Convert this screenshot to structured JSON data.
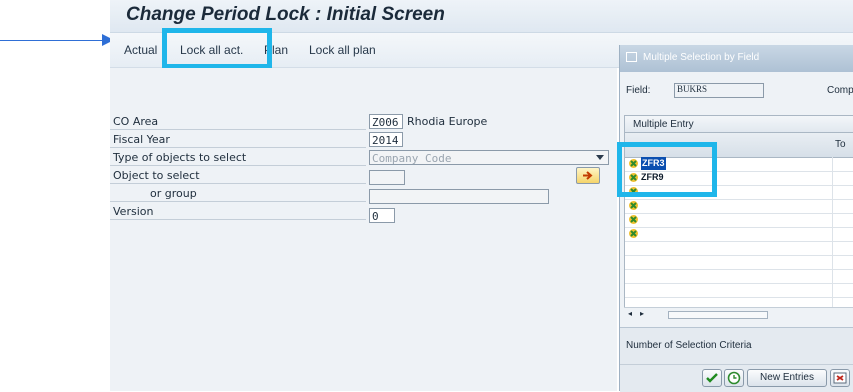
{
  "window": {
    "title": "Change Period Lock : Initial Screen"
  },
  "toolbar": {
    "items": [
      {
        "label": "Actual"
      },
      {
        "label": "Lock all act."
      },
      {
        "label": "Plan"
      },
      {
        "label": "Lock all plan"
      }
    ]
  },
  "form": {
    "co_area": {
      "label": "CO Area",
      "value": "Z006",
      "description": "Rhodia Europe"
    },
    "fiscal_year": {
      "label": "Fiscal Year",
      "value": "2014"
    },
    "object_type": {
      "label": "Type of objects to select",
      "value": "Company Code"
    },
    "object_to_select": {
      "label": "Object to select",
      "value": ""
    },
    "or_group": {
      "label": "or group",
      "value": ""
    },
    "version": {
      "label": "Version",
      "value": "0"
    }
  },
  "dialog": {
    "title": "Multiple Selection by Field",
    "field_label": "Field:",
    "field_value": "BUKRS",
    "field_desc": "Comp",
    "section": "Multiple Entry",
    "col_to": "To",
    "rows": [
      "ZFR3",
      "ZFR9",
      "",
      "",
      "",
      ""
    ],
    "count_label": "Number of Selection Criteria",
    "new_entries": "New Entries"
  },
  "colors": {
    "highlight": "#1fb6ea",
    "arrow": "#2f6fd6"
  }
}
